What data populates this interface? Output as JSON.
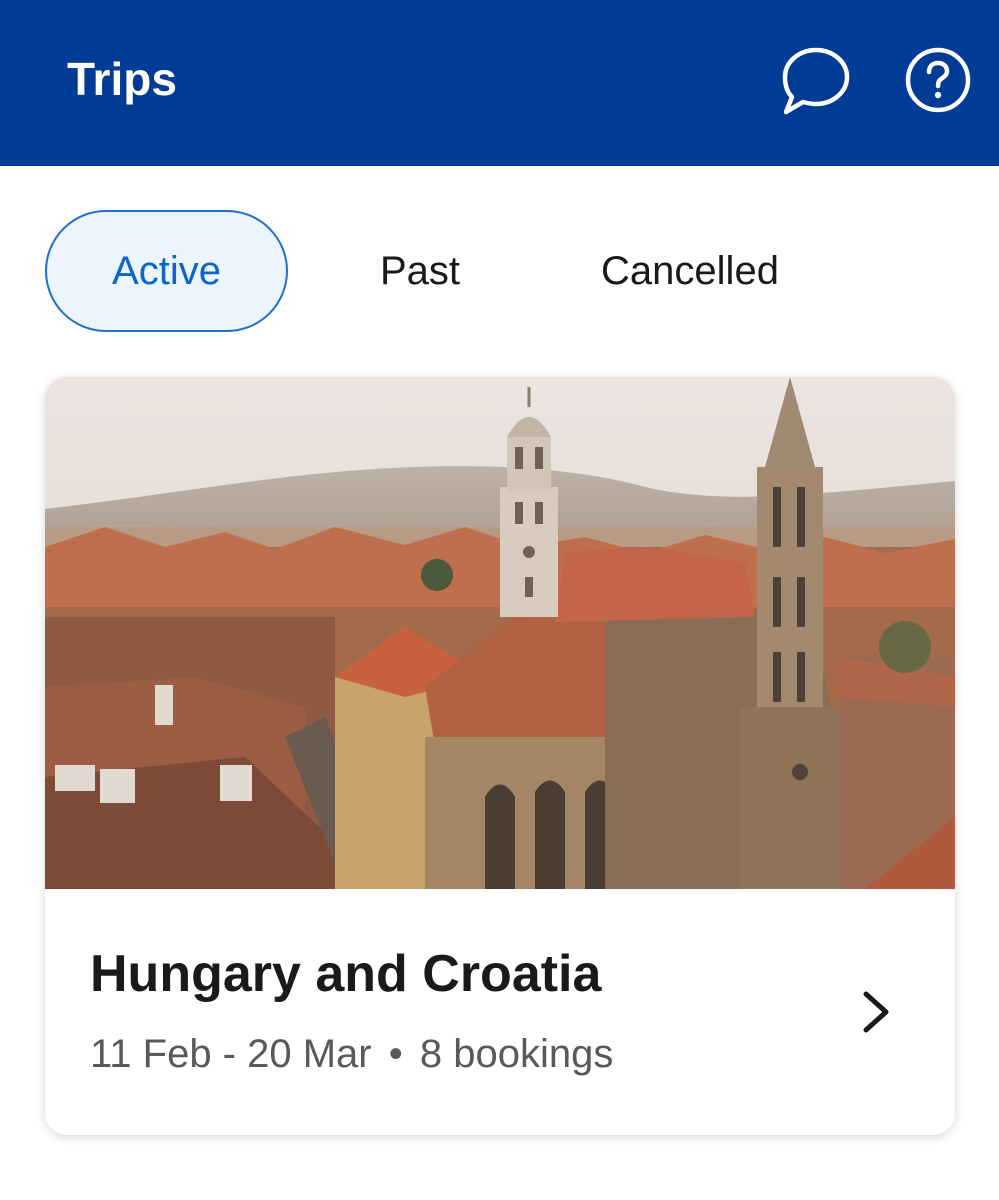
{
  "header": {
    "title": "Trips",
    "background_color": "#003b95",
    "icons": [
      "chat-bubble-icon",
      "help-icon"
    ]
  },
  "tabs": [
    {
      "label": "Active",
      "selected": true
    },
    {
      "label": "Past",
      "selected": false
    },
    {
      "label": "Cancelled",
      "selected": false
    }
  ],
  "accent_color": "#1e6fd0",
  "trip_card": {
    "image": "Aerial view of old town with red-tiled roofs and church spires",
    "title": "Hungary and Croatia",
    "dates": "11 Feb - 20 Mar",
    "separator": "•",
    "bookings": "8 bookings",
    "icon": "chevron-right-icon"
  }
}
